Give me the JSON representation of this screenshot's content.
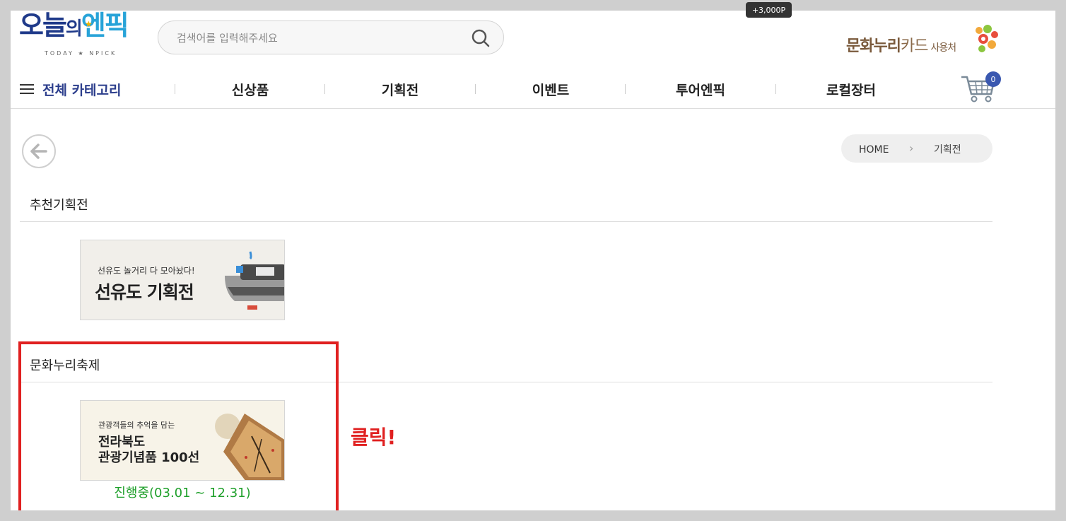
{
  "points_tooltip": "+3,000P",
  "logo": {
    "part1": "오늘",
    "part2": "의",
    "part3": "엔픽",
    "sub": "TODAY ★ NPICK"
  },
  "search": {
    "placeholder": "검색어를 입력해주세요",
    "value": "",
    "icon": "search-icon"
  },
  "culture_card": {
    "part_bold": "문화누리",
    "part_thin": "카드",
    "suffix": "사용처"
  },
  "nav": {
    "all_category": "전체 카테고리",
    "items": [
      "신상품",
      "기획전",
      "이벤트",
      "투어엔픽",
      "로컬장터"
    ],
    "cart_count": "0"
  },
  "breadcrumb": {
    "home": "HOME",
    "separator": "›",
    "current": "기획전"
  },
  "sections": [
    {
      "title": "추천기획전",
      "banner": {
        "sub": "선유도 놀거리 다 모아놨다!",
        "main": "선유도 기획전"
      }
    },
    {
      "title": "문화누리축제",
      "banner": {
        "sub": "관광객들의 추억을 담는",
        "main_line1": "전라북도",
        "main_line2": "관광기념품 100선"
      },
      "period": "진행중(03.01 ~ 12.31)"
    }
  ],
  "annotation": {
    "text": "클릭!",
    "color": "#e02020"
  },
  "colors": {
    "brand_navy": "#2c3e8c",
    "accent_blue": "#27a3d8",
    "status_green": "#1fa02b",
    "cart_badge": "#3a58b0"
  }
}
